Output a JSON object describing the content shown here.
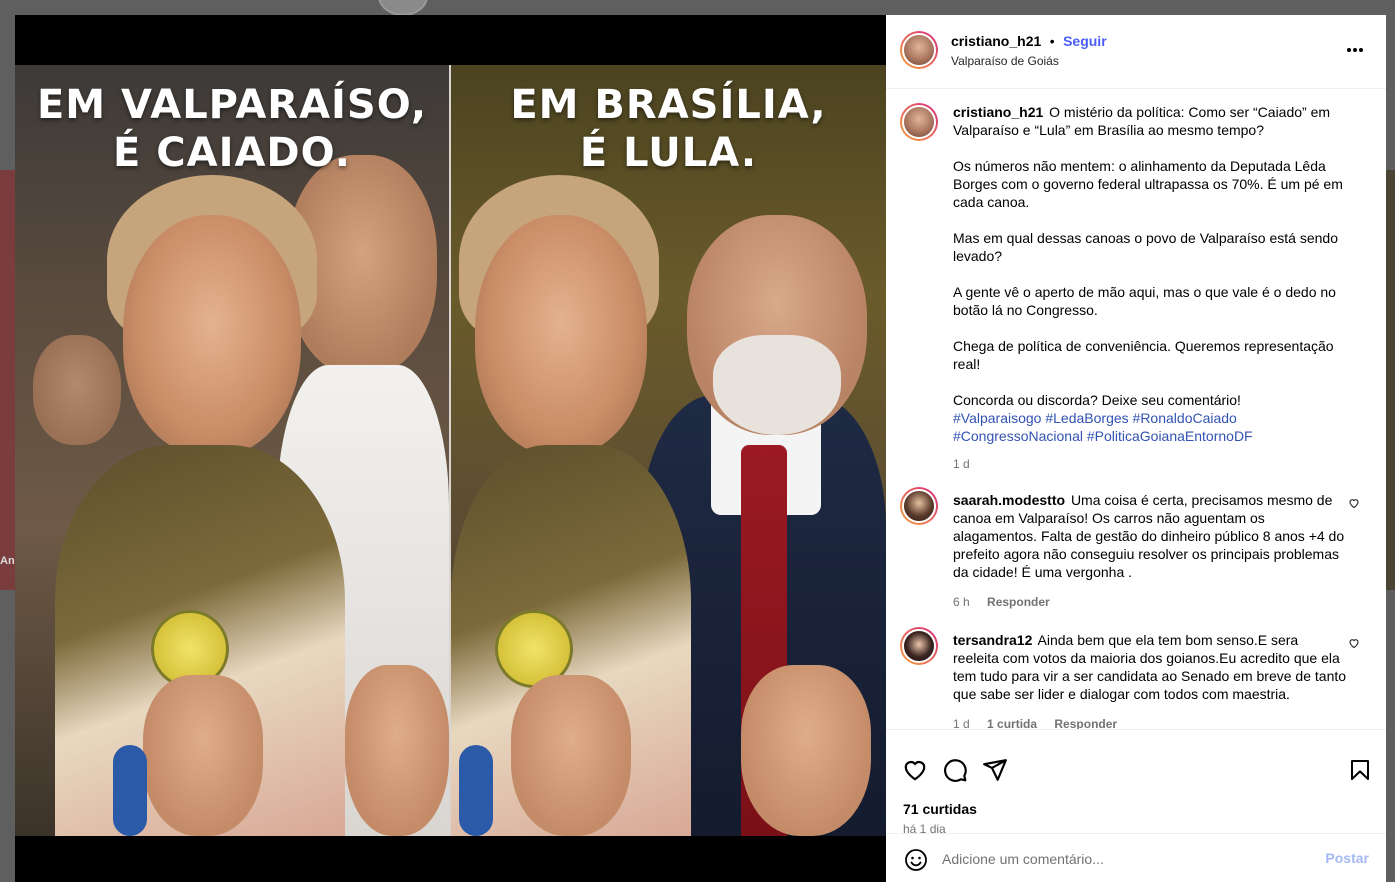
{
  "media": {
    "left_caption_line1": "EM VALPARAÍSO,",
    "left_caption_line2": "É CAIADO.",
    "right_caption_line1": "EM BRASÍLIA,",
    "right_caption_line2": "É LULA."
  },
  "header": {
    "username": "cristiano_h21",
    "separator": "•",
    "follow_label": "Seguir",
    "location": "Valparaíso de Goiás",
    "more_icon": "more-horizontal-icon"
  },
  "caption": {
    "username": "cristiano_h21",
    "paragraphs": [
      "O mistério da política: Como ser “Caiado” em Valparaíso e “Lula” em Brasília ao mesmo tempo?",
      "Os números não mentem: o alinhamento da Deputada Lêda Borges com o governo federal ultrapassa os 70%. É um pé em cada canoa.",
      "Mas em qual dessas canoas o povo de Valparaíso está sendo levado?",
      "A gente vê o aperto de mão aqui, mas o que vale é o dedo no botão lá no Congresso.",
      "Chega de política de conveniência. Queremos representação real!",
      "Concorda ou discorda? Deixe seu comentário!"
    ],
    "hashtags_line1": "#Valparaisogo #LedaBorges #RonaldoCaiado",
    "hashtags_line2": "#CongressoNacional #PoliticaGoianaEntornoDF",
    "age": "1 d"
  },
  "comments": [
    {
      "username": "saarah.modestto",
      "text": "Uma coisa é certa, precisamos mesmo de canoa em Valparaíso! Os carros não aguentam os alagamentos. Falta de gestão do dinheiro público 8 anos +4 do prefeito agora não conseguiu resolver os principais problemas da cidade! É uma vergonha .",
      "age": "6 h",
      "reply_label": "Responder"
    },
    {
      "username": "tersandra12",
      "text": "Ainda bem que ela tem bom senso.E sera reeleita com votos da maioria dos goianos.Eu acredito que ela tem tudo para vir a ser candidata ao Senado em breve de tanto que sabe ser lider e dialogar com todos com maestria.",
      "age": "1 d",
      "likes": "1 curtida",
      "reply_label": "Responder"
    }
  ],
  "actions": {
    "likes": "71 curtidas",
    "posted": "há 1 dia",
    "icons": [
      "heart-icon",
      "comment-icon",
      "share-icon",
      "bookmark-icon"
    ]
  },
  "composer": {
    "placeholder": "Adicione um comentário...",
    "post_label": "Postar"
  },
  "background": {
    "left_label": "An"
  },
  "colors": {
    "accent": "#4a5df9",
    "hashtag": "#3253b3",
    "muted": "#737373",
    "post_disabled": "#a5b9f5"
  }
}
